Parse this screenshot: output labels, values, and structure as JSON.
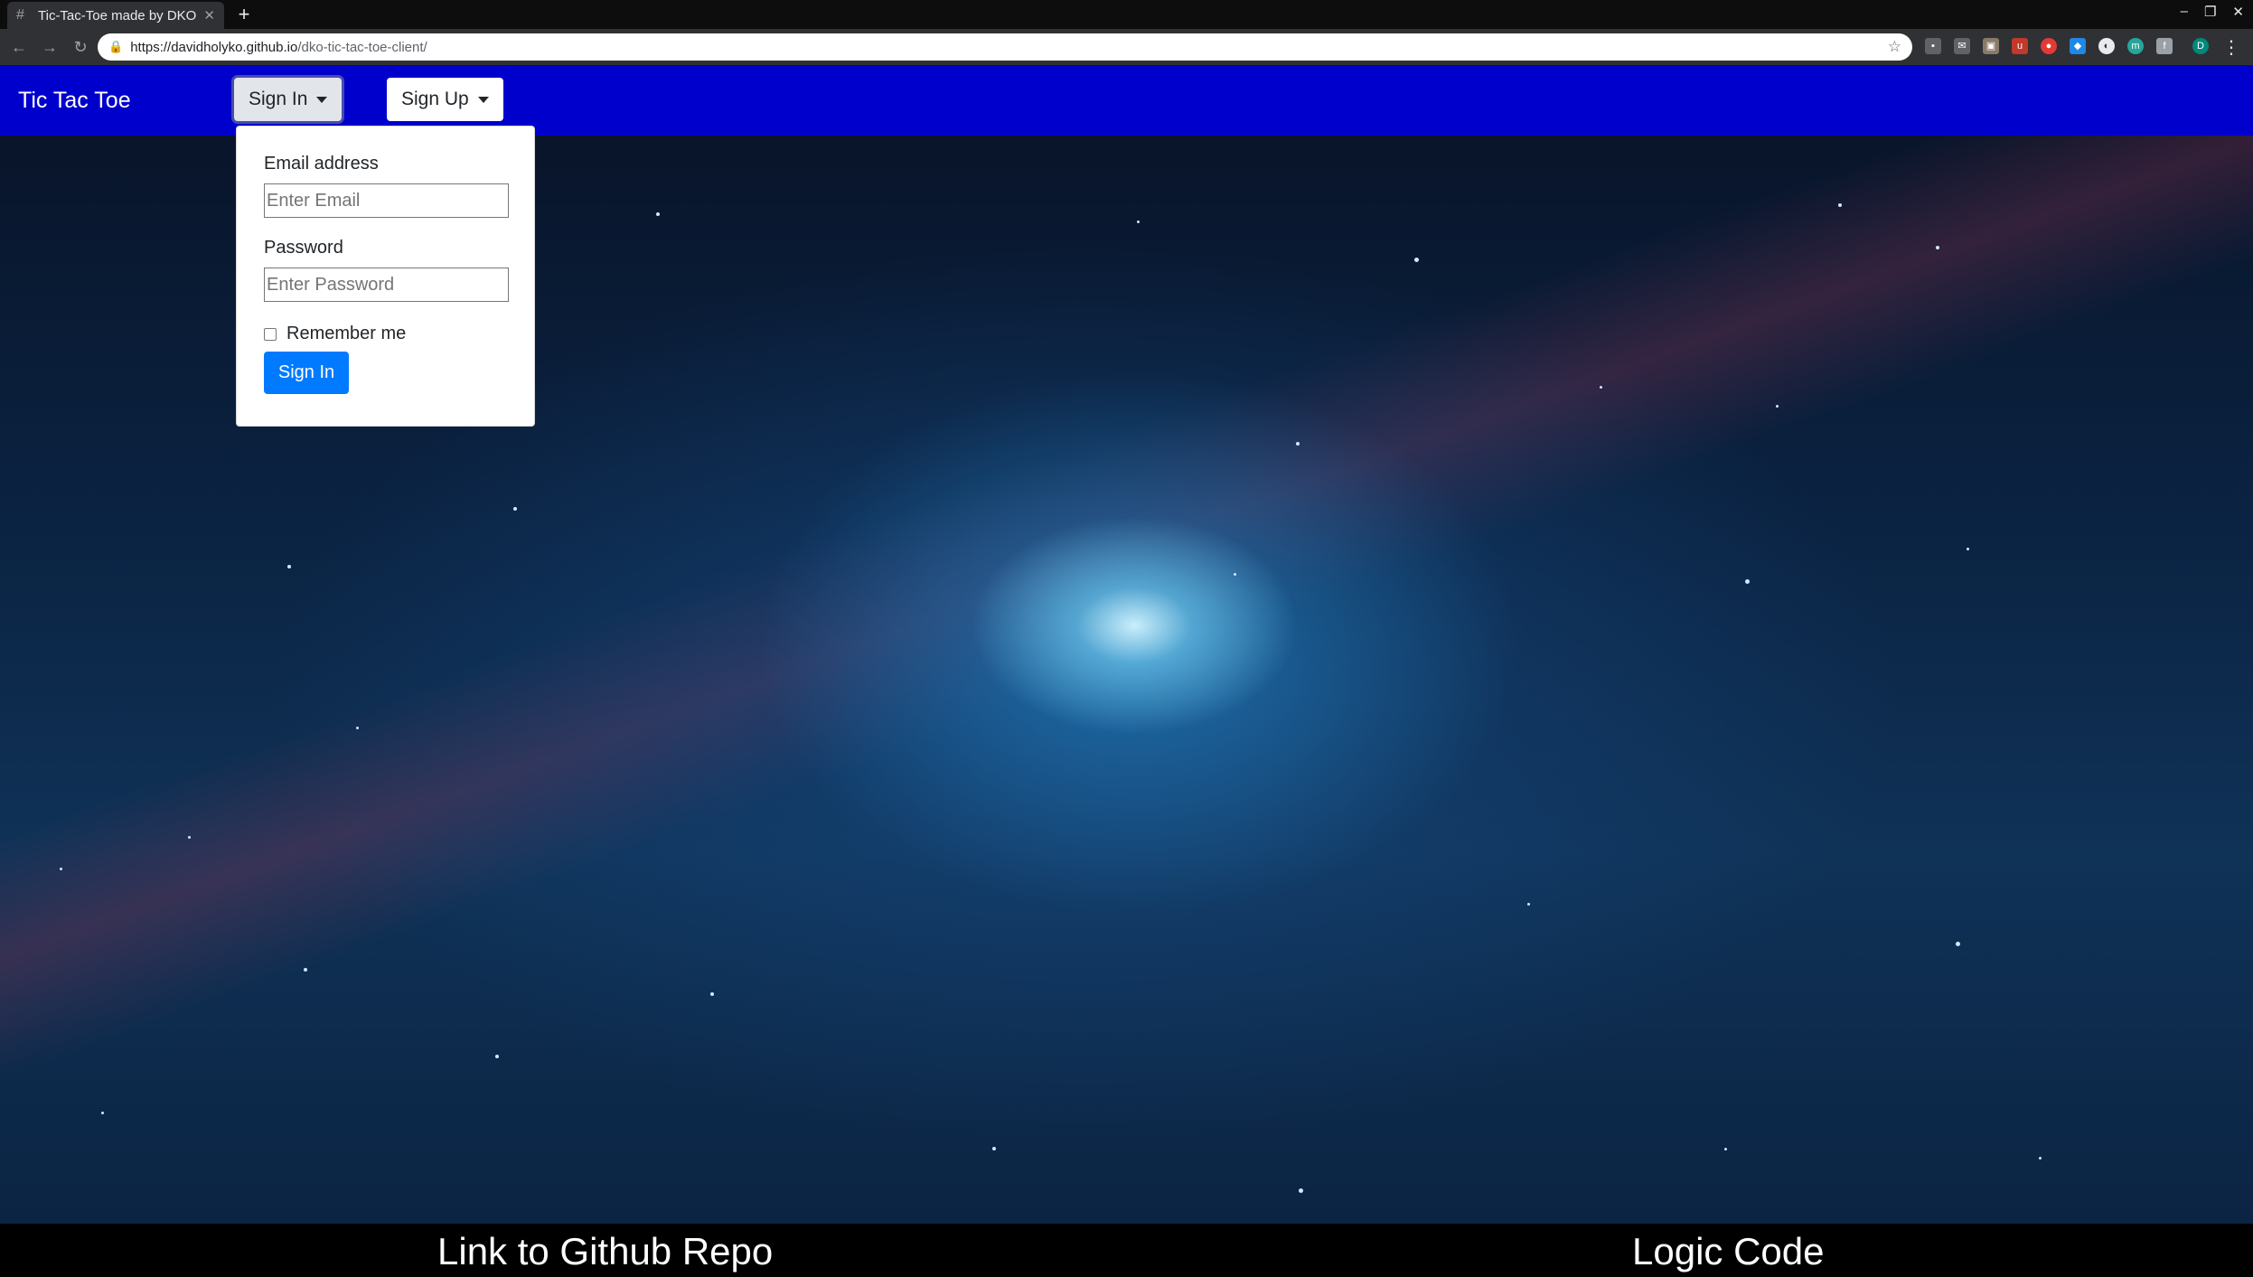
{
  "browser": {
    "tab_title": "Tic-Tac-Toe made by DKO",
    "url_host": "https://davidholyko.github.io",
    "url_path": "/dko-tic-tac-toe-client/",
    "profile_initial": "D"
  },
  "navbar": {
    "brand": "Tic Tac Toe",
    "sign_in_label": "Sign In",
    "sign_up_label": "Sign Up"
  },
  "sign_in_form": {
    "email_label": "Email address",
    "email_placeholder": "Enter Email",
    "password_label": "Password",
    "password_placeholder": "Enter Password",
    "remember_label": "Remember me",
    "submit_label": "Sign In"
  },
  "footer": {
    "github_link": "Link to Github Repo",
    "logic_link": "Logic Code"
  },
  "colors": {
    "navbar_bg": "#0000cc",
    "primary_button": "#007bff",
    "footer_bg": "#000000"
  }
}
